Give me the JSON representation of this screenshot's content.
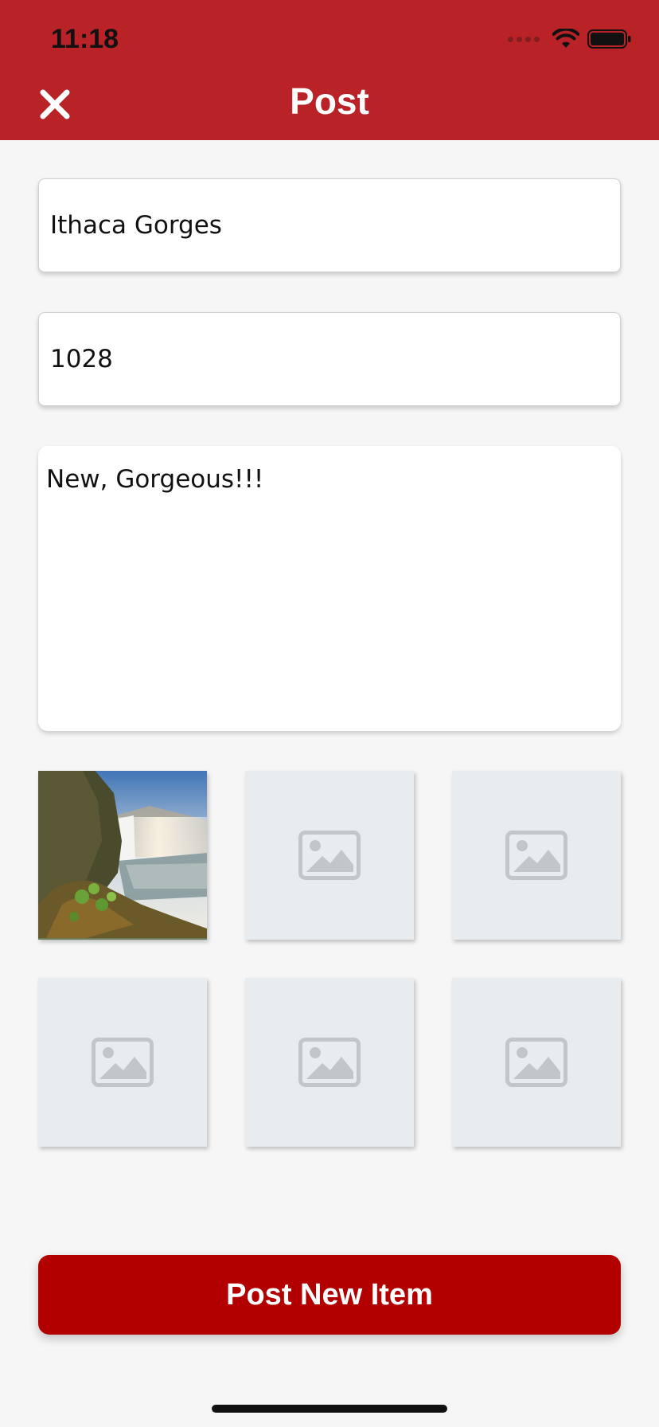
{
  "status_bar": {
    "time": "11:18"
  },
  "header": {
    "title": "Post",
    "close_icon": "close-icon"
  },
  "form": {
    "title_value": "Ithaca Gorges",
    "price_value": "1028",
    "description_value": "New, Gorgeous!!!"
  },
  "photos": [
    {
      "filled": true,
      "icon": "waterfall-photo"
    },
    {
      "filled": false,
      "icon": "image-placeholder-icon"
    },
    {
      "filled": false,
      "icon": "image-placeholder-icon"
    },
    {
      "filled": false,
      "icon": "image-placeholder-icon"
    },
    {
      "filled": false,
      "icon": "image-placeholder-icon"
    },
    {
      "filled": false,
      "icon": "image-placeholder-icon"
    }
  ],
  "actions": {
    "post_label": "Post New Item"
  },
  "colors": {
    "header": "#b92327",
    "button": "#b20000",
    "background": "#f6f6f6",
    "placeholder": "#e8ecef"
  }
}
